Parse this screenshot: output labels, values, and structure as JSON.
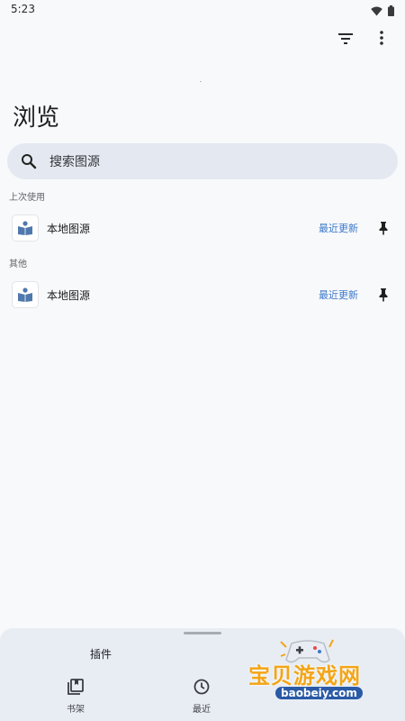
{
  "status_bar": {
    "time": "5:23"
  },
  "page": {
    "title": "浏览"
  },
  "search": {
    "placeholder": "搜索图源"
  },
  "sections": [
    {
      "label": "上次使用",
      "items": [
        {
          "name": "本地图源",
          "action": "最近更新"
        }
      ]
    },
    {
      "label": "其他",
      "items": [
        {
          "name": "本地图源",
          "action": "最近更新"
        }
      ]
    }
  ],
  "bottom_sheet": {
    "plugin_label": "插件",
    "nav": [
      {
        "label": "书架",
        "icon": "library-icon"
      },
      {
        "label": "最近",
        "icon": "clock-icon"
      }
    ]
  },
  "watermark": {
    "text": "宝贝游戏网",
    "sub": "baobeiy.com"
  },
  "colors": {
    "accent": "#3a78c9",
    "search_bg": "#e4e9f1",
    "sheet_bg": "#e8edf4"
  }
}
